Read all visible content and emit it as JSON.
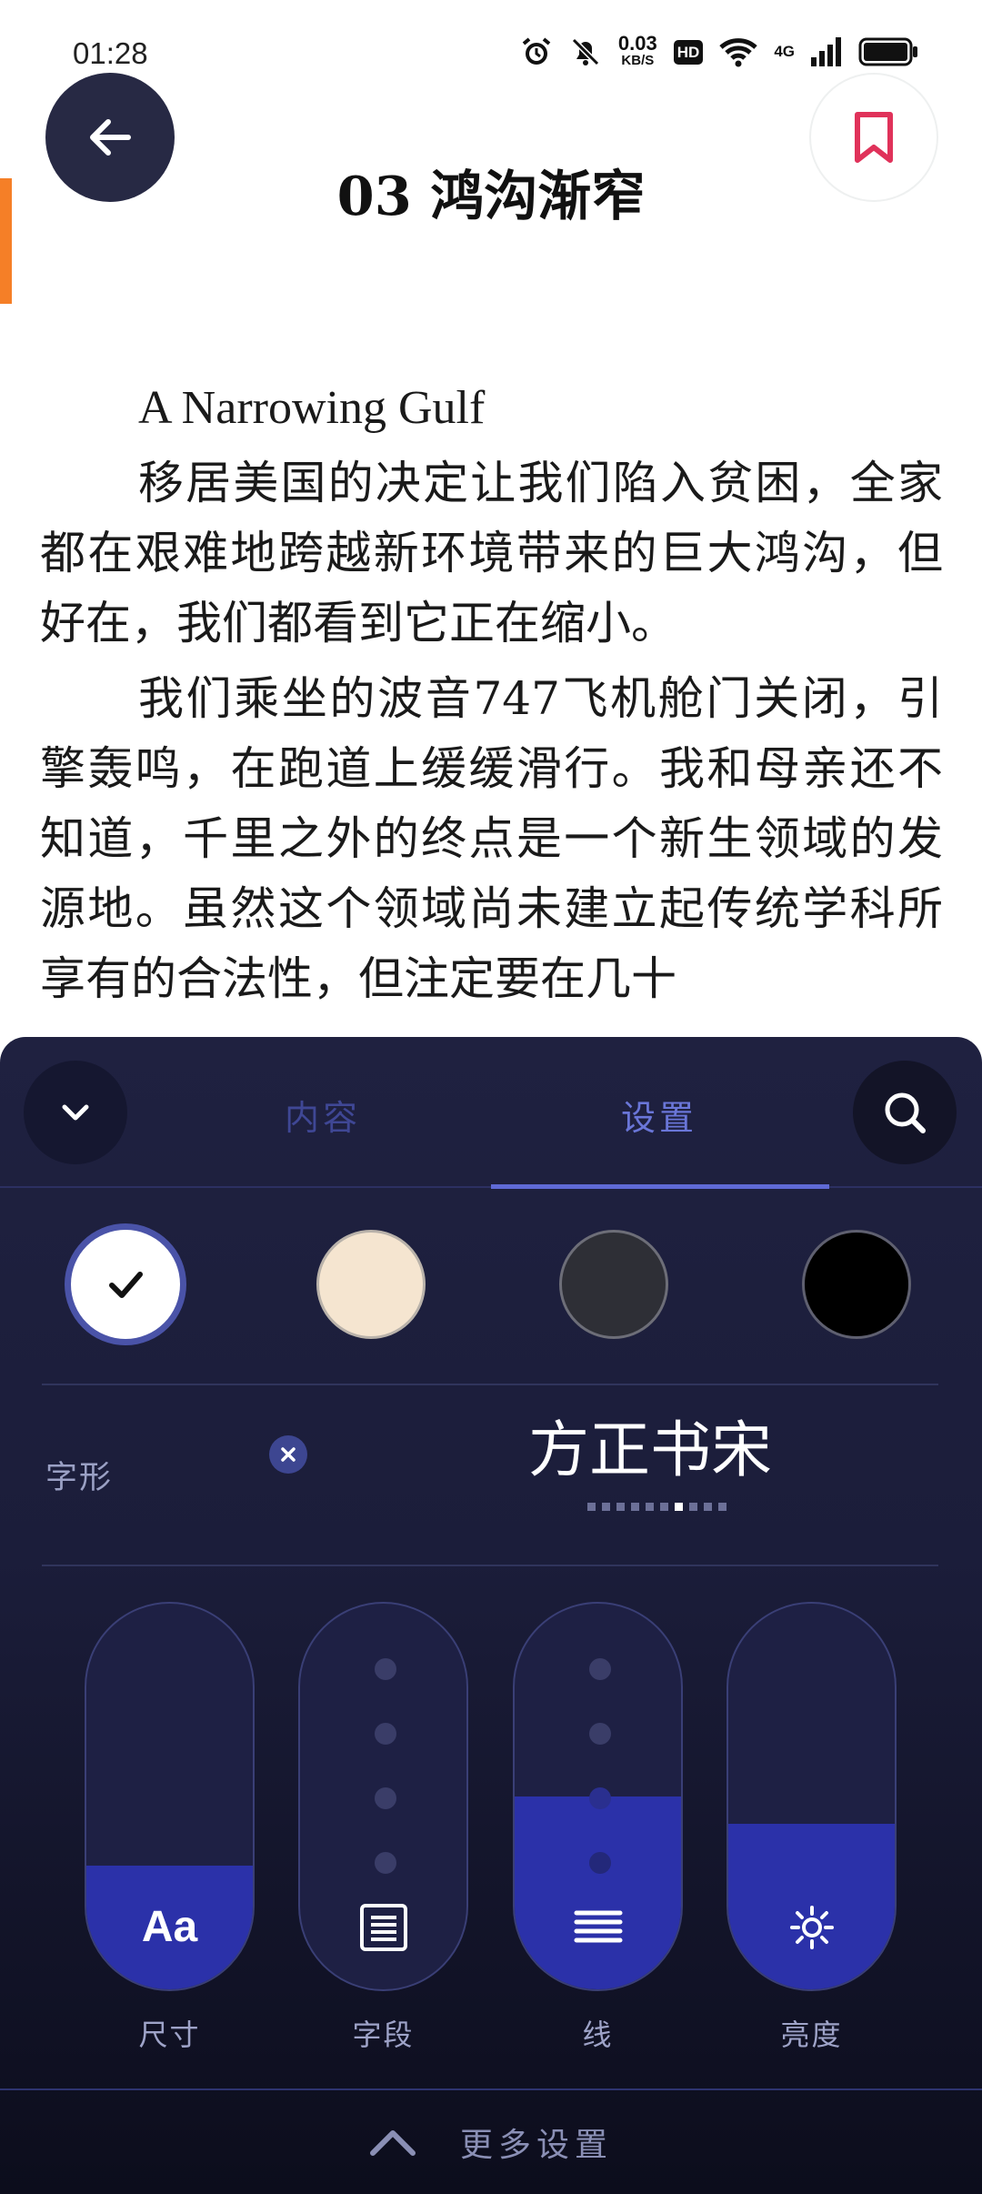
{
  "status_bar": {
    "time": "01:28",
    "network_speed": "0.03",
    "network_speed_unit": "KB/S",
    "hd_label": "HD",
    "network_type": "4G",
    "icons": [
      "alarm-icon",
      "mute-icon",
      "wifi-icon",
      "signal-icon",
      "battery-icon"
    ]
  },
  "reader": {
    "chapter_title": "03 鸿沟渐窄",
    "paragraphs": [
      "A Narrowing Gulf",
      "移居美国的决定让我们陷入贫困，全家都在艰难地跨越新环境带来的巨大鸿沟，但好在，我们都看到它正在缩小。",
      "我们乘坐的波音747飞机舱门关闭，引擎轰鸣，在跑道上缓缓滑行。我和母亲还不知道，千里之外的终点是一个新生领域的发源地。虽然这个领域尚未建立起传统学科所享有的合法性，但注定要在几十"
    ]
  },
  "panel": {
    "tabs": {
      "content": "内容",
      "settings": "设置"
    },
    "active_tab": "settings",
    "themes": [
      {
        "name": "white",
        "color": "#ffffff",
        "selected": true
      },
      {
        "name": "cream",
        "color": "#f5e5d0",
        "selected": false
      },
      {
        "name": "gray",
        "color": "#2e2f36",
        "selected": false
      },
      {
        "name": "black",
        "color": "#000000",
        "selected": false
      }
    ],
    "font": {
      "label": "字形",
      "current": "方正书宋",
      "page_index": 6,
      "page_count": 9
    },
    "sliders": [
      {
        "caption": "尺寸",
        "icon": "Aa",
        "level": 0.32
      },
      {
        "caption": "字段",
        "icon": "paragraph-icon",
        "level": 0.0
      },
      {
        "caption": "线",
        "icon": "line-spacing-icon",
        "level": 0.5
      },
      {
        "caption": "亮度",
        "icon": "brightness-icon",
        "level": 0.43
      }
    ],
    "more_settings": "更多设置"
  },
  "colors": {
    "accent": "#5f6ad6",
    "edge_marker": "#f57f27",
    "bookmark": "#e0325a",
    "slider_fill": "#2b31a9"
  }
}
